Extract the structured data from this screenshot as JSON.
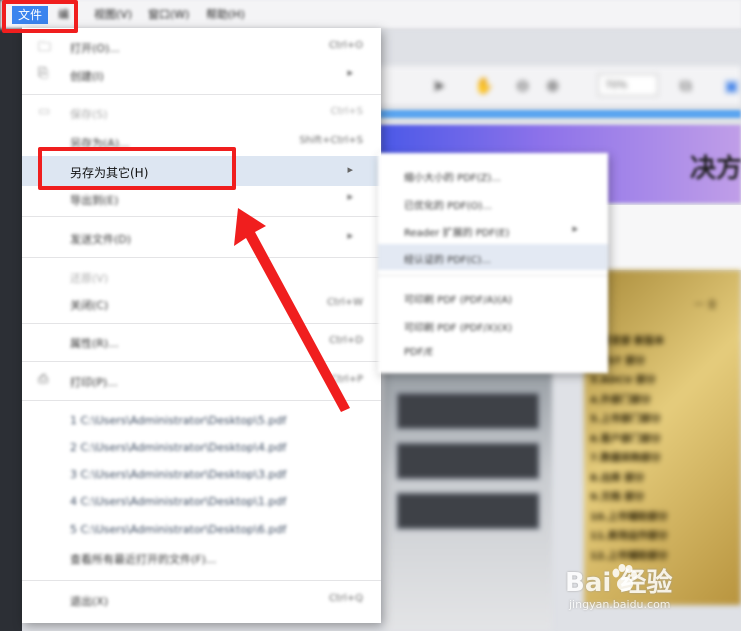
{
  "menubar": {
    "file_label": "文件",
    "items": [
      "编",
      "视图(V)",
      "窗口(W)",
      "帮助(H)"
    ]
  },
  "menu": {
    "items": [
      {
        "label": "打开(O)...",
        "shortcut": "Ctrl+O",
        "icon": "folder-open-icon"
      },
      {
        "label": "创建(I)",
        "submenu": true,
        "icon": "create-pdf-icon"
      },
      {
        "label": "保存(S)",
        "shortcut": "Ctrl+S",
        "icon": "save-icon",
        "disabled": true
      },
      {
        "label": "另存为(A)...",
        "shortcut": "Shift+Ctrl+S"
      },
      {
        "label": "另存为其它(H)",
        "submenu": true,
        "highlighted": true
      },
      {
        "label": "导出到(E)",
        "submenu": true
      },
      {
        "label": "发送文件(D)",
        "submenu": true
      },
      {
        "label": "还原(V)",
        "disabled": true
      },
      {
        "label": "关闭(C)",
        "shortcut": "Ctrl+W"
      },
      {
        "label": "属性(R)...",
        "shortcut": "Ctrl+D"
      },
      {
        "label": "打印(P)...",
        "shortcut": "Ctrl+P",
        "icon": "printer-icon"
      },
      {
        "label": "1 C:\\Users\\Administrator\\Desktop\\5.pdf"
      },
      {
        "label": "2 C:\\Users\\Administrator\\Desktop\\4.pdf"
      },
      {
        "label": "3 C:\\Users\\Administrator\\Desktop\\3.pdf"
      },
      {
        "label": "4 C:\\Users\\Administrator\\Desktop\\1.pdf"
      },
      {
        "label": "5 C:\\Users\\Administrator\\Desktop\\6.pdf"
      },
      {
        "label": "查看所有最近打开的文件(F)..."
      },
      {
        "label": "退出(X)",
        "shortcut": "Ctrl+Q"
      }
    ]
  },
  "submenu": {
    "items": [
      {
        "label": "缩小大小的 PDF(Z)..."
      },
      {
        "label": "已优化的 PDF(O)..."
      },
      {
        "label": "Reader 扩展的 PDF(E)",
        "submenu": true
      },
      {
        "label": "经认证的 PDF(C)...",
        "highlighted": true
      },
      {
        "label": "可印刷 PDF (PDF/A)(A)"
      },
      {
        "label": "可印刷 PDF (PDF/X)(X)"
      },
      {
        "label": "PDF/E"
      }
    ]
  },
  "document": {
    "banner_title": "决方法",
    "zoom": "70%",
    "gold_heading": "一  全",
    "gold_lines": [
      "1.研发部   新版本",
      "2.TST  部分",
      "3.ADCU  部分",
      "4.外部门部分",
      "5.上市部门部分",
      "6.客户部门部分",
      "7.数据采购部分",
      "8.出库  部分",
      "9.文档  部分",
      "10.上市辅助部分",
      "11.卖场运作部分",
      "12.上市辅助部分"
    ]
  },
  "watermark": {
    "brand": "Bai  经验",
    "url": "jingyan.baidu.com"
  },
  "colors": {
    "accent": "#3b84ee",
    "annotation_red": "#f01e1e",
    "highlight": "#dde6f2"
  }
}
